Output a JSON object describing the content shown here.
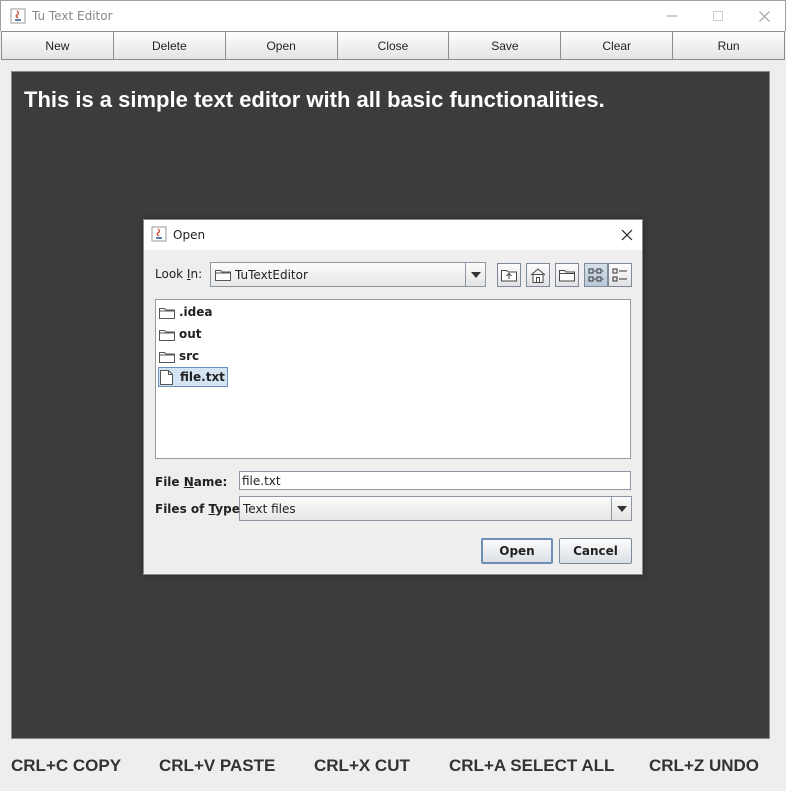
{
  "window": {
    "title": "Tu Text Editor"
  },
  "toolbar": {
    "buttons": [
      "New",
      "Delete",
      "Open",
      "Close",
      "Save",
      "Clear",
      "Run"
    ]
  },
  "editor": {
    "text": "This is a simple text editor with all basic functionalities.",
    "background": "#3c3c3c",
    "text_color": "#ffffff"
  },
  "shortcuts": {
    "copy": "CRL+C COPY",
    "paste": "CRL+V PASTE",
    "cut": "CRL+X CUT",
    "select_all": "CRL+A SELECT ALL",
    "undo": "CRL+Z UNDO"
  },
  "dialog": {
    "title": "Open",
    "look_in_label_pre": "Look ",
    "look_in_label_mnemonic": "I",
    "look_in_label_post": "n:",
    "look_in_value": "TuTextEditor",
    "toolbar_icons": [
      "up-one-level-icon",
      "home-icon",
      "new-folder-icon",
      "list-view-icon",
      "details-view-icon"
    ],
    "files": [
      {
        "name": ".idea",
        "type": "folder"
      },
      {
        "name": "out",
        "type": "folder"
      },
      {
        "name": "src",
        "type": "folder"
      },
      {
        "name": "file.txt",
        "type": "file",
        "selected": true
      }
    ],
    "file_name_label_pre": "File ",
    "file_name_label_mnemonic": "N",
    "file_name_label_post": "ame:",
    "file_name_value": "file.txt",
    "file_type_label_pre": "Files of ",
    "file_type_label_mnemonic": "T",
    "file_type_label_post": "ype:",
    "file_type_value": "Text files",
    "open_button": "Open",
    "cancel_button": "Cancel",
    "selection_color": "#d5e4f3"
  }
}
